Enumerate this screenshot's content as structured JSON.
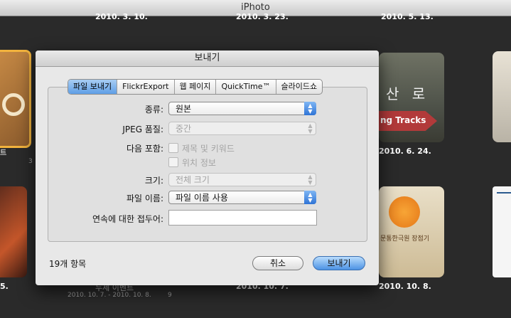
{
  "window": {
    "title": "iPhoto"
  },
  "background": {
    "top_dates": [
      "2010. 3. 10.",
      "2010. 3. 23.",
      "2010. 5. 13."
    ],
    "mid_left_label": "트",
    "mid_left_count": "3",
    "mid_right_date": "2010. 6. 24.",
    "sign_text_1": "산 로",
    "sign_text_2": "ng Tracks",
    "book_text": "문통한극원 장점기",
    "bottom_left_date": "5.",
    "bottom_event_title": "두세 이벤트",
    "bottom_event_range": "2010. 10. 7. - 2010. 10. 8.",
    "bottom_event_count": "9",
    "bottom_mid_date": "2010. 10. 7.",
    "bottom_right_date": "2010. 10. 8."
  },
  "dialog": {
    "title": "보내기",
    "tabs": [
      {
        "label": "파일 보내기",
        "selected": true
      },
      {
        "label": "FlickrExport",
        "selected": false
      },
      {
        "label": "웹 페이지",
        "selected": false
      },
      {
        "label": "QuickTime™",
        "selected": false
      },
      {
        "label": "슬라이드쇼",
        "selected": false
      }
    ],
    "kind": {
      "label": "종류:",
      "value": "원본"
    },
    "jpeg_quality": {
      "label": "JPEG 품질:",
      "value": "중간"
    },
    "include": {
      "label": "다음 포함:",
      "opt1": "제목 및 키워드",
      "opt2": "위치 정보"
    },
    "size": {
      "label": "크기:",
      "value": "전체 크기"
    },
    "filename": {
      "label": "파일 이름:",
      "value": "파일 이름 사용"
    },
    "prefix": {
      "label": "연속에 대한 접두어:",
      "value": ""
    },
    "item_count": "19개 항목",
    "cancel_label": "취소",
    "export_label": "보내기"
  },
  "colors": {
    "accent": "#4d93e4",
    "bg": "#2a2a2a"
  }
}
